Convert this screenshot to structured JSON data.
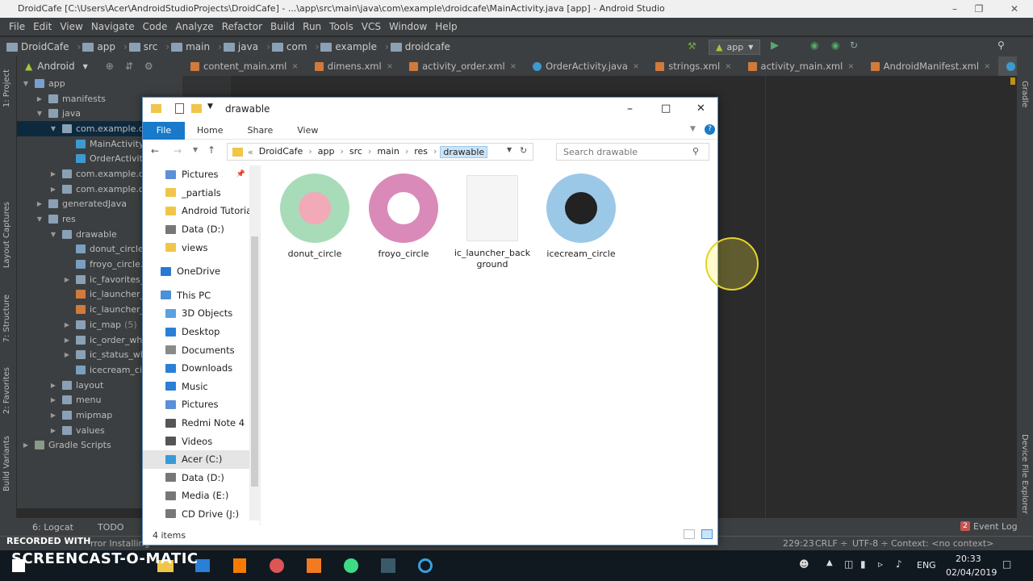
{
  "window": {
    "title": "DroidCafe [C:\\Users\\Acer\\AndroidStudioProjects\\DroidCafe] - ...\\app\\src\\main\\java\\com\\example\\droidcafe\\MainActivity.java [app] - Android Studio"
  },
  "menu": [
    "File",
    "Edit",
    "View",
    "Navigate",
    "Code",
    "Analyze",
    "Refactor",
    "Build",
    "Run",
    "Tools",
    "VCS",
    "Window",
    "Help"
  ],
  "nav_crumbs": [
    "DroidCafe",
    "app",
    "src",
    "main",
    "java",
    "com",
    "example",
    "droidcafe"
  ],
  "run_config": "app",
  "project_view": {
    "label": "Android"
  },
  "tree": [
    {
      "label": "app",
      "depth": 0,
      "open": true,
      "color": "#7a9fcf"
    },
    {
      "label": "manifests",
      "depth": 1,
      "open": false,
      "color": "#8aa0b5"
    },
    {
      "label": "java",
      "depth": 1,
      "open": true,
      "color": "#8aa0b5"
    },
    {
      "label": "com.example.dro",
      "depth": 2,
      "open": true,
      "color": "#8aa0b5",
      "selected": true
    },
    {
      "label": "MainActivity",
      "depth": 3,
      "leaf": true,
      "color": "#3c9ad0"
    },
    {
      "label": "OrderActivity",
      "depth": 3,
      "leaf": true,
      "color": "#3c9ad0"
    },
    {
      "label": "com.example.dro",
      "depth": 2,
      "open": false,
      "color": "#8aa0b5"
    },
    {
      "label": "com.example.dro",
      "depth": 2,
      "open": false,
      "color": "#8aa0b5"
    },
    {
      "label": "generatedJava",
      "depth": 1,
      "open": false,
      "color": "#8aa0b5"
    },
    {
      "label": "res",
      "depth": 1,
      "open": true,
      "color": "#8aa0b5"
    },
    {
      "label": "drawable",
      "depth": 2,
      "open": true,
      "color": "#8aa0b5"
    },
    {
      "label": "donut_circle.p",
      "depth": 3,
      "leaf": true,
      "color": "#7a9fbf"
    },
    {
      "label": "froyo_circle.p",
      "depth": 3,
      "leaf": true,
      "color": "#7a9fbf"
    },
    {
      "label": "ic_favorites_w",
      "depth": 3,
      "open": false,
      "color": "#8aa0b5"
    },
    {
      "label": "ic_launcher_b",
      "depth": 3,
      "leaf": true,
      "color": "#d07a3c"
    },
    {
      "label": "ic_launcher_fo",
      "depth": 3,
      "leaf": true,
      "color": "#d07a3c"
    },
    {
      "label": "ic_map",
      "depth": 3,
      "open": false,
      "color": "#8aa0b5",
      "count": "(5)"
    },
    {
      "label": "ic_order_white",
      "depth": 3,
      "open": false,
      "color": "#8aa0b5"
    },
    {
      "label": "ic_status_whit",
      "depth": 3,
      "open": false,
      "color": "#8aa0b5"
    },
    {
      "label": "icecream_circ",
      "depth": 3,
      "leaf": true,
      "color": "#7a9fbf"
    },
    {
      "label": "layout",
      "depth": 2,
      "open": false,
      "color": "#8aa0b5"
    },
    {
      "label": "menu",
      "depth": 2,
      "open": false,
      "color": "#8aa0b5"
    },
    {
      "label": "mipmap",
      "depth": 2,
      "open": false,
      "color": "#8aa0b5"
    },
    {
      "label": "values",
      "depth": 2,
      "open": false,
      "color": "#8aa0b5"
    },
    {
      "label": "Gradle Scripts",
      "depth": 0,
      "open": false,
      "color": "#8a9a8a"
    }
  ],
  "editor_tabs": [
    {
      "label": "content_main.xml",
      "color": "#d07a3c"
    },
    {
      "label": "dimens.xml",
      "color": "#d07a3c"
    },
    {
      "label": "activity_order.xml",
      "color": "#d07a3c"
    },
    {
      "label": "OrderActivity.java",
      "color": "#3c9ad0"
    },
    {
      "label": "strings.xml",
      "color": "#d07a3c"
    },
    {
      "label": "activity_main.xml",
      "color": "#d07a3c"
    },
    {
      "label": "AndroidManifest.xml",
      "color": "#d07a3c"
    },
    {
      "label": "MainActivity.java",
      "color": "#3c9ad0",
      "active": true
    }
  ],
  "side_tabs": {
    "project": "1: Project",
    "captures": "Layout Captures",
    "structure": "7: Structure",
    "favorites": "2: Favorites",
    "variants": "Build Variants",
    "gradle": "Gradle",
    "device": "Device File Explorer"
  },
  "bottom": {
    "logcat": "6: Logcat",
    "todo": "TODO",
    "event_log": "Event Log",
    "event_count": "2"
  },
  "status": {
    "message": "rror Installing",
    "position": "229:23",
    "line_sep": "CRLF ÷",
    "encoding": "UTF-8 ÷",
    "context": "Context: <no context>"
  },
  "explorer": {
    "title": "drawable",
    "ribbon": [
      "File",
      "Home",
      "Share",
      "View"
    ],
    "address": [
      "DroidCafe",
      "app",
      "src",
      "main",
      "res",
      "drawable"
    ],
    "search_placeholder": "Search drawable",
    "nav": [
      {
        "label": "Pictures",
        "icon": "pictures-icon",
        "color": "#5b8fd8",
        "indent": 1,
        "pinned": true
      },
      {
        "label": "_partials",
        "icon": "folder-icon",
        "color": "#f0c64a",
        "indent": 1
      },
      {
        "label": "Android Tutorial",
        "icon": "folder-icon",
        "color": "#f0c64a",
        "indent": 1
      },
      {
        "label": "Data (D:)",
        "icon": "drive-icon",
        "color": "#777",
        "indent": 1
      },
      {
        "label": "views",
        "icon": "folder-icon",
        "color": "#f0c64a",
        "indent": 1
      },
      {
        "label": "",
        "spacer": true
      },
      {
        "label": "OneDrive",
        "icon": "cloud-icon",
        "color": "#2a78d6",
        "indent": 0
      },
      {
        "label": "",
        "spacer": true
      },
      {
        "label": "This PC",
        "icon": "pc-icon",
        "color": "#4b91d6",
        "indent": 0
      },
      {
        "label": "3D Objects",
        "icon": "cube-icon",
        "color": "#5ba0e0",
        "indent": 1
      },
      {
        "label": "Desktop",
        "icon": "desktop-icon",
        "color": "#2a7fd6",
        "indent": 1
      },
      {
        "label": "Documents",
        "icon": "documents-icon",
        "color": "#8a8a8a",
        "indent": 1
      },
      {
        "label": "Downloads",
        "icon": "download-icon",
        "color": "#2a7fd6",
        "indent": 1
      },
      {
        "label": "Music",
        "icon": "music-icon",
        "color": "#2a7fd6",
        "indent": 1
      },
      {
        "label": "Pictures",
        "icon": "pictures-icon",
        "color": "#5b8fd8",
        "indent": 1
      },
      {
        "label": "Redmi Note 4",
        "icon": "phone-icon",
        "color": "#555",
        "indent": 1
      },
      {
        "label": "Videos",
        "icon": "video-icon",
        "color": "#555",
        "indent": 1
      },
      {
        "label": "Acer (C:)",
        "icon": "drive-icon",
        "color": "#3a9ad8",
        "indent": 1,
        "selected": true
      },
      {
        "label": "Data (D:)",
        "icon": "drive-icon",
        "color": "#777",
        "indent": 1
      },
      {
        "label": "Media (E:)",
        "icon": "drive-icon",
        "color": "#777",
        "indent": 1
      },
      {
        "label": "CD Drive (J:)",
        "icon": "disc-icon",
        "color": "#777",
        "indent": 1
      }
    ],
    "files": [
      {
        "name": "donut_circle",
        "bg": "#a8dcb8",
        "accent": "#f2a9b8"
      },
      {
        "name": "froyo_circle",
        "bg": "#d98ab8",
        "accent": "#ffffff"
      },
      {
        "name": "ic_launcher_background",
        "display": "ic_launcher_back\nground",
        "blank": true
      },
      {
        "name": "icecream_circle",
        "bg": "#9cc8e8",
        "accent": "#222222"
      }
    ],
    "status": "4 items"
  },
  "taskbar": {
    "time": "20:33",
    "date": "02/04/2019",
    "lang": "ENG"
  },
  "watermark": {
    "line1": "RECORDED WITH",
    "line2": "SCREENCAST-O-MATIC"
  }
}
